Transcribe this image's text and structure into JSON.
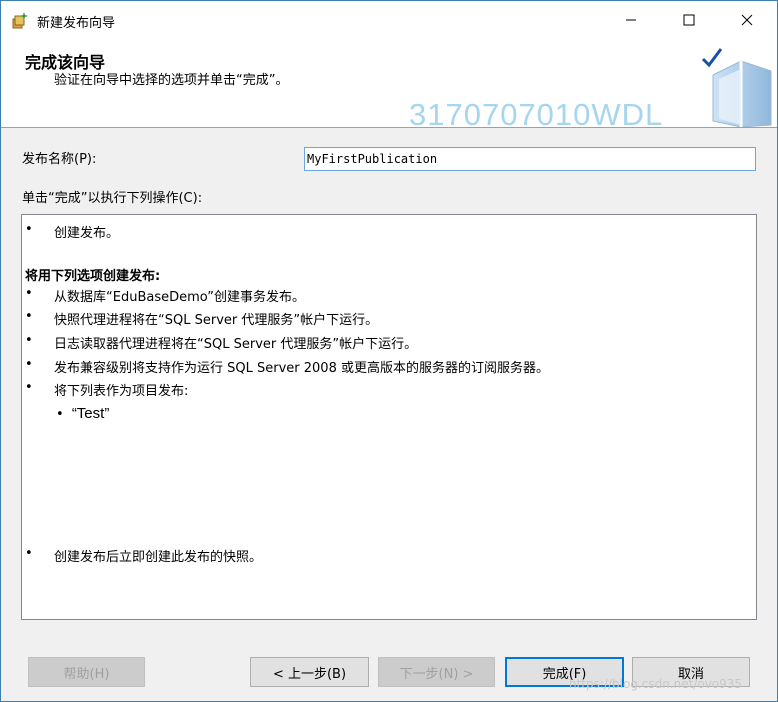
{
  "window": {
    "title": "新建发布向导"
  },
  "header": {
    "title": "完成该向导",
    "subtitle": "验证在向导中选择的选项并单击“完成”。",
    "watermark": "3170707010WDL"
  },
  "publication": {
    "name_label": "发布名称(P):",
    "name_value": "MyFirstPublication"
  },
  "actions_label": "单击“完成”以执行下列操作(C):",
  "actions": {
    "item1": "创建发布。",
    "section_heading": "将用下列选项创建发布:",
    "opt1": "从数据库“EduBaseDemo”创建事务发布。",
    "opt2": "快照代理进程将在“SQL Server 代理服务”帐户下运行。",
    "opt3": "日志读取器代理进程将在“SQL Server 代理服务”帐户下运行。",
    "opt4": "发布兼容级别将支持作为运行 SQL Server 2008 或更高版本的服务器的订阅服务器。",
    "opt5": "将下列表作为项目发布:",
    "article1": "“Test”",
    "last": "创建发布后立即创建此发布的快照。"
  },
  "buttons": {
    "help": "帮助(H)",
    "back": "< 上一步(B)",
    "next": "下一步(N) >",
    "finish": "完成(F)",
    "cancel": "取消"
  },
  "footer_watermark": "https://blog.csdn.net/ovo935",
  "colors": {
    "accent": "#0078d7",
    "watermark": "#a5d6ee",
    "border": "#3c7fb1"
  }
}
